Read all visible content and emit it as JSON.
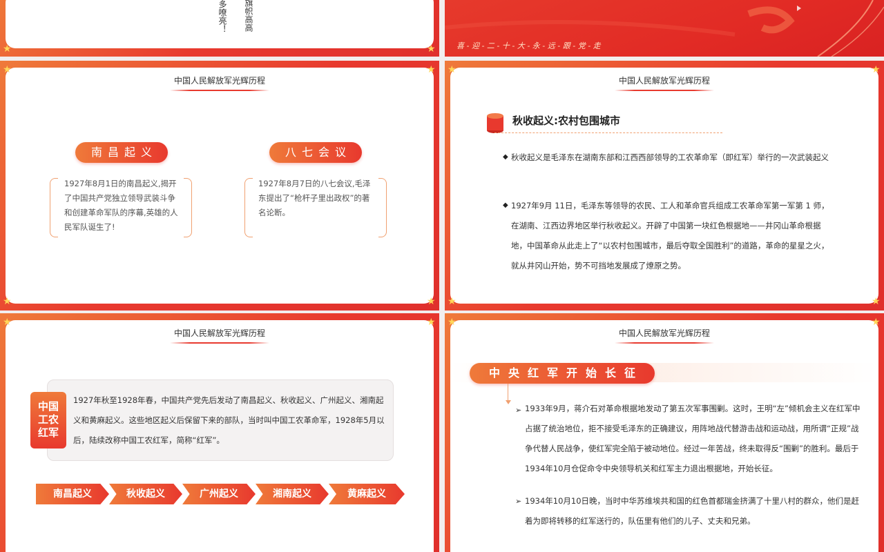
{
  "slide1": {
    "vertical_text_a": "多嘹亮！",
    "vertical_text_b": "旗帜高高"
  },
  "slide2": {
    "slogan": "喜 - 迎 - 二 - 十 - 大 - 永 - 远 - 跟 - 党 - 走"
  },
  "slide3": {
    "section_title": "中国人民解放军光辉历程",
    "left_title": "南昌起义",
    "left_text": "1927年8月1日的南昌起义,揭开了中国共产党独立领导武装斗争和创建革命军队的序幕,英雄的人民军队诞生了!",
    "right_title": "八七会议",
    "right_text": "1927年8月7日的八七会议,毛泽东提出了“枪杆子里出政权”的著名论断。"
  },
  "slide4": {
    "section_title": "中国人民解放军光辉历程",
    "heading": "秋收起义:农村包围城市",
    "bullet1": "秋收起义是毛泽东在湖南东部和江西西部领导的工农革命军（即红军）举行的一次武装起义",
    "bullet2": "1927年9月 11日，毛泽东等领导的农民、工人和革命官兵组成工农革命军第一军第 1 师，在湖南、江西边界地区举行秋收起义。开辟了中国第一块红色根据地——井冈山革命根据地，中国革命从此走上了“以农村包围城市，最后夺取全国胜利”的道路，革命的星星之火，就从井冈山开始，势不可挡地发展成了燎原之势。"
  },
  "slide5": {
    "section_title": "中国人民解放军光辉历程",
    "badge_label": "中国工农红军",
    "box_text": "1927年秋至1928年春，中国共产党先后发动了南昌起义、秋收起义、广州起义、湘南起义和黄麻起义。这些地区起义后保留下来的部队，当时叫中国工农革命军，1928年5月以后，陆续改称中国工农红军，简称“红军”。",
    "steps": [
      "南昌起义",
      "秋收起义",
      "广州起义",
      "湘南起义",
      "黄麻起义"
    ]
  },
  "slide6": {
    "section_title": "中国人民解放军光辉历程",
    "heading": "中央红军开始长征",
    "bullet1": "1933年9月，蒋介石对革命根据地发动了第五次军事围剿。这时，王明“左”倾机会主义在红军中占据了统治地位，拒不接受毛泽东的正确建议，用阵地战代替游击战和运动战，用所谓“正规”战争代替人民战争，使红军完全陷于被动地位。经过一年苦战，终未取得反“围剿”的胜利。最后于1934年10月仓促命令中央领导机关和红军主力退出根据地，开始长征。",
    "bullet2": "1934年10月10日晚，当时中华苏维埃共和国的红色首都瑞金挤满了十里八村的群众，他们是赶着为即将转移的红军送行的，队伍里有他们的儿子、丈夫和兄弟。"
  },
  "icons": {
    "star": "★",
    "diamond": "◆",
    "chevron": "➢"
  },
  "colors": {
    "brand_red": "#e8392e",
    "brand_orange": "#ef7a3a",
    "star_gold": "#ffd75a"
  }
}
